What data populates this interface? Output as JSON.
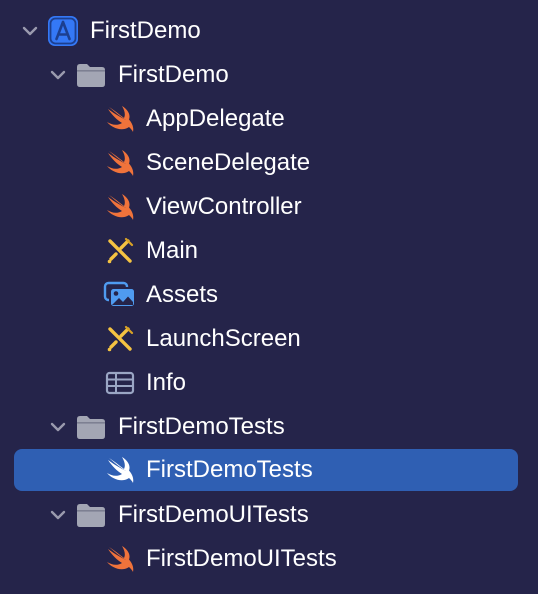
{
  "navigator": {
    "project": {
      "label": "FirstDemo",
      "icon": "xcode-project-icon",
      "expanded": true
    },
    "groups": [
      {
        "label": "FirstDemo",
        "icon": "folder-icon",
        "expanded": true,
        "items": [
          {
            "label": "AppDelegate",
            "icon": "swift-icon"
          },
          {
            "label": "SceneDelegate",
            "icon": "swift-icon"
          },
          {
            "label": "ViewController",
            "icon": "swift-icon"
          },
          {
            "label": "Main",
            "icon": "storyboard-icon"
          },
          {
            "label": "Assets",
            "icon": "asset-catalog-icon"
          },
          {
            "label": "LaunchScreen",
            "icon": "storyboard-icon"
          },
          {
            "label": "Info",
            "icon": "plist-icon"
          }
        ]
      },
      {
        "label": "FirstDemoTests",
        "icon": "folder-icon",
        "expanded": true,
        "items": [
          {
            "label": "FirstDemoTests",
            "icon": "swift-icon",
            "selected": true
          }
        ]
      },
      {
        "label": "FirstDemoUITests",
        "icon": "folder-icon",
        "expanded": true,
        "items": [
          {
            "label": "FirstDemoUITests",
            "icon": "swift-icon"
          }
        ]
      }
    ]
  },
  "colors": {
    "background": "#25244a",
    "selection": "#2f5fb3",
    "swift": "#f0733b",
    "folder": "#a3a6b4",
    "chevron": "#9a9aae",
    "project": "#3478f6",
    "storyboard": "#f5c342"
  }
}
